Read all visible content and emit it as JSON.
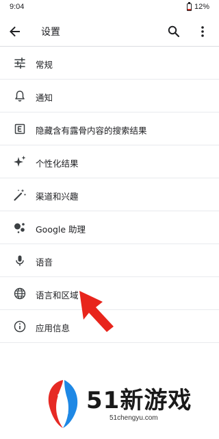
{
  "status": {
    "time": "9:04",
    "battery": "12%"
  },
  "app_bar": {
    "title": "设置"
  },
  "settings": [
    {
      "label": "常规",
      "icon": "tune-icon"
    },
    {
      "label": "通知",
      "icon": "bell-icon"
    },
    {
      "label": "隐藏含有露骨内容的搜索结果",
      "icon": "explicit-icon"
    },
    {
      "label": "个性化结果",
      "icon": "sparkle-icon"
    },
    {
      "label": "渠道和兴趣",
      "icon": "magic-wand-icon"
    },
    {
      "label": "Google 助理",
      "icon": "assistant-icon"
    },
    {
      "label": "语音",
      "icon": "mic-icon"
    },
    {
      "label": "语言和区域",
      "icon": "globe-icon"
    },
    {
      "label": "应用信息",
      "icon": "info-icon"
    }
  ],
  "watermark": {
    "title": "51新游戏",
    "subtitle": "51chengyu.com"
  },
  "colors": {
    "arrow": "#e8251c",
    "text": "#202124",
    "divider": "#e8eaed"
  }
}
